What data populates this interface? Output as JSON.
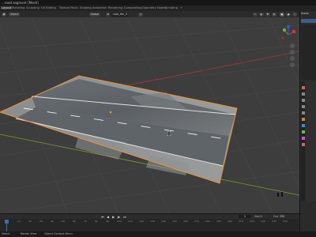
{
  "titlebar": {
    "title": "…road segment [Mesh]",
    "controls": [
      "–",
      "□",
      "✕"
    ]
  },
  "menubar": {
    "tabs": [
      "Layout",
      "Modeling",
      "Sculpting",
      "UV Editing",
      "Texture Paint",
      "Shading",
      "Animation",
      "Rendering",
      "Compositing",
      "Geometry Nodes",
      "Scripting",
      "+"
    ],
    "active_index": 0
  },
  "header": {
    "mode_label": "Object",
    "view_label": "Global",
    "object_field": "road_tile_0"
  },
  "right_panel": {
    "scene_label": "Scene"
  },
  "timeline": {
    "ticks": [
      "0",
      "10",
      "20",
      "30",
      "40",
      "50",
      "60",
      "70",
      "80",
      "90",
      "100",
      "110",
      "120",
      "130",
      "140",
      "150",
      "160",
      "170",
      "180",
      "190",
      "200",
      "210",
      "220",
      "230",
      "240",
      "250"
    ],
    "current_frame": "1",
    "start_label": "Start",
    "start_value": "1",
    "end_label": "End",
    "end_value": "250"
  },
  "statusbar": {
    "left": "Select",
    "middle": "Rotate View",
    "right": "Object Context Menu"
  },
  "colors": {
    "accent": "#e8923a",
    "axis_x": "#a33b3b",
    "axis_y": "#7c9a32"
  }
}
